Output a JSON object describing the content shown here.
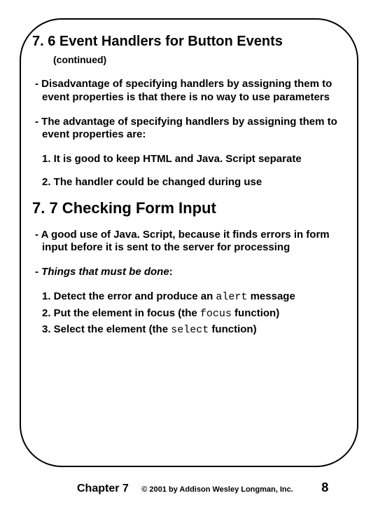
{
  "section_7_6": {
    "title": "7. 6 Event Handlers for Button Events",
    "continued": "(continued)",
    "disadvantage": "- Disadvantage of specifying handlers by assigning them to event properties is that there is no way to use parameters",
    "advantage_intro": "- The advantage of specifying handlers by assigning them to event properties are:",
    "points": [
      "1. It is good to keep HTML and Java. Script separate",
      "2. The handler could be changed during use"
    ]
  },
  "section_7_7": {
    "title": "7. 7 Checking Form Input",
    "good_use": "- A good use of Java. Script, because it finds errors in form input before it is sent to the server for processing",
    "must_prefix": "- ",
    "must_label": "Things that must be done",
    "must_suffix": ":",
    "steps": {
      "s1_a": "1. Detect the error and produce an ",
      "s1_code": "alert",
      "s1_b": " message",
      "s2_a": "2. Put the element in focus (the ",
      "s2_code": "focus",
      "s2_b": " function)",
      "s3_a": "3. Select the element (the ",
      "s3_code": "select",
      "s3_b": " function)"
    }
  },
  "footer": {
    "chapter": "Chapter 7",
    "copy": "© 2001 by Addison Wesley Longman, Inc.",
    "page": "8"
  }
}
